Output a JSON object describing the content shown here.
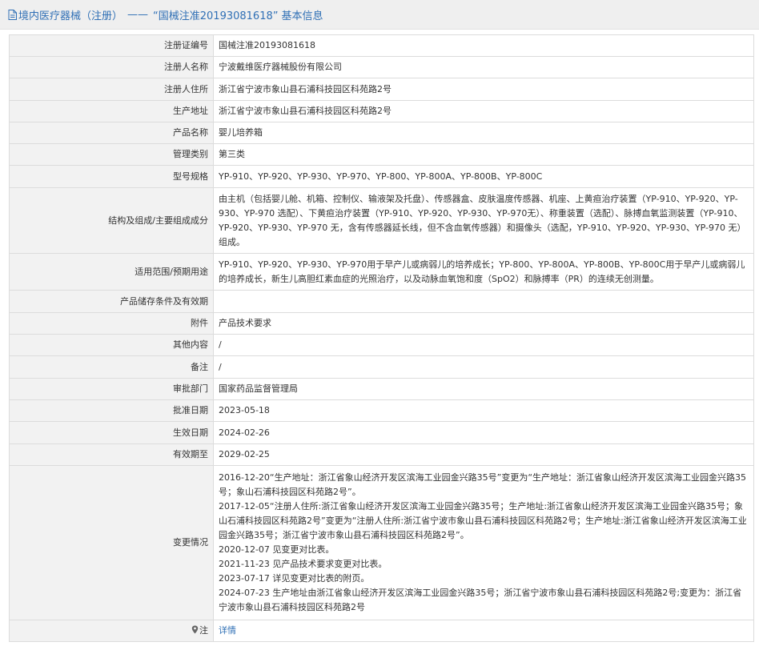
{
  "header": {
    "category": "境内医疗器械（注册）",
    "separator": "——",
    "record_title": "“国械注准20193081618”",
    "suffix": "基本信息"
  },
  "rows": [
    {
      "label": "注册证编号",
      "value": "国械注准20193081618"
    },
    {
      "label": "注册人名称",
      "value": "宁波戴维医疗器械股份有限公司"
    },
    {
      "label": "注册人住所",
      "value": "浙江省宁波市象山县石浦科技园区科苑路2号"
    },
    {
      "label": "生产地址",
      "value": "浙江省宁波市象山县石浦科技园区科苑路2号"
    },
    {
      "label": "产品名称",
      "value": "婴儿培养箱"
    },
    {
      "label": "管理类别",
      "value": "第三类"
    },
    {
      "label": "型号规格",
      "value": "YP-910、YP-920、YP-930、YP-970、YP-800、YP-800A、YP-800B、YP-800C"
    },
    {
      "label": "结构及组成/主要组成成分",
      "value": "由主机（包括婴儿舱、机箱、控制仪、输液架及托盘）、传感器盒、皮肤温度传感器、机座、上黄疸治疗装置（YP-910、YP-920、YP-930、YP-970 选配）、下黄疸治疗装置（YP-910、YP-920、YP-930、YP-970无）、称重装置（选配）、脉搏血氧监测装置（YP-910、YP-920、YP-930、YP-970 无，含有传感器延长线，但不含血氧传感器）和摄像头（选配，YP-910、YP-920、YP-930、YP-970 无）组成。"
    },
    {
      "label": "适用范围/预期用途",
      "value": "YP-910、YP-920、YP-930、YP-970用于早产儿或病弱儿的培养成长；YP-800、YP-800A、YP-800B、YP-800C用于早产儿或病弱儿的培养成长，新生儿高胆红素血症的光照治疗，以及动脉血氧饱和度（SpO2）和脉搏率（PR）的连续无创测量。"
    },
    {
      "label": "产品储存条件及有效期",
      "value": ""
    },
    {
      "label": "附件",
      "value": "产品技术要求"
    },
    {
      "label": "其他内容",
      "value": "/"
    },
    {
      "label": "备注",
      "value": "/"
    },
    {
      "label": "审批部门",
      "value": "国家药品监督管理局"
    },
    {
      "label": "批准日期",
      "value": "2023-05-18"
    },
    {
      "label": "生效日期",
      "value": "2024-02-26"
    },
    {
      "label": "有效期至",
      "value": "2029-02-25"
    }
  ],
  "changes": {
    "label": "变更情况",
    "entries": [
      "2016-12-20“生产地址：浙江省象山经济开发区滨海工业园金兴路35号”变更为“生产地址：浙江省象山经济开发区滨海工业园金兴路35号；象山石浦科技园区科苑路2号”。",
      "2017-12-05“注册人住所:浙江省象山经济开发区滨海工业园金兴路35号；生产地址:浙江省象山经济开发区滨海工业园金兴路35号；象山石浦科技园区科苑路2号”变更为“注册人住所:浙江省宁波市象山县石浦科技园区科苑路2号；生产地址:浙江省象山经济开发区滨海工业园金兴路35号；浙江省宁波市象山县石浦科技园区科苑路2号”。",
      "2020-12-07 见变更对比表。",
      "2021-11-23 见产品技术要求变更对比表。",
      "2023-07-17 详见变更对比表的附页。",
      "2024-07-23 生产地址由浙江省象山经济开发区滨海工业园金兴路35号；浙江省宁波市象山县石浦科技园区科苑路2号;变更为：浙江省宁波市象山县石浦科技园区科苑路2号"
    ]
  },
  "note": {
    "label": "注",
    "link_text": "详情",
    "icon": "map-pin-icon"
  },
  "colors": {
    "accent": "#2f6fb5",
    "label_bg": "#f2f2f2",
    "border": "#dcdcdc"
  }
}
